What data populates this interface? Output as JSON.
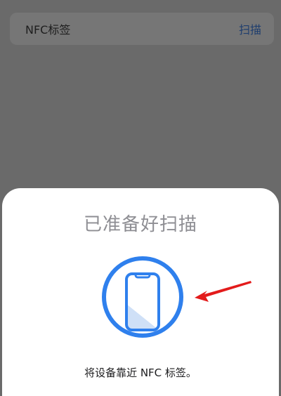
{
  "settings_row": {
    "label": "NFC标签",
    "action": "扫描"
  },
  "scan_sheet": {
    "title": "已准备好扫描",
    "instruction": "将设备靠近 NFC 标签。",
    "icon": "phone-nfc-icon",
    "pointer": "red-arrow-icon"
  },
  "colors": {
    "backdrop": "#6a6a6a",
    "row_background": "#767676",
    "accent": "#2f80ed",
    "arrow": "#e31b1b",
    "title": "#8e8e93"
  }
}
